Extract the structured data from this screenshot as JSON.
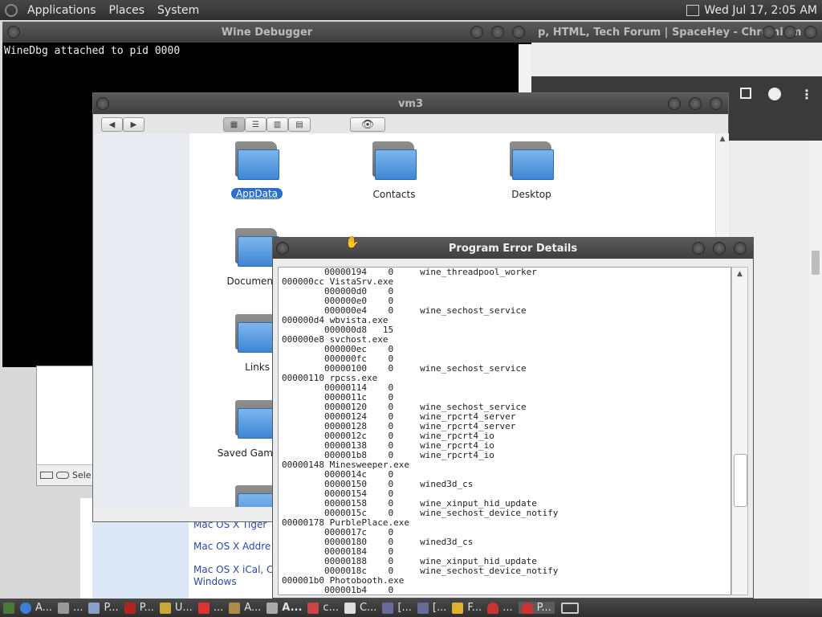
{
  "top_panel": {
    "menus": [
      "Applications",
      "Places",
      "System"
    ],
    "clock": "Wed Jul 17,  2:05 AM"
  },
  "chromium": {
    "title": "p, HTML, Tech Forum | SpaceHey - Chromium",
    "page_links": [
      "Mac OS X Tiger",
      "Mac OS X Addre",
      "Mac OS X iCal, C",
      "Windows"
    ]
  },
  "debugger": {
    "title": "Wine Debugger",
    "console_text": "WineDbg attached to pid 0000"
  },
  "side_window": {
    "status_text": "Sele"
  },
  "file_manager": {
    "title": "vm3",
    "folders": [
      {
        "label": "AppData",
        "selected": true
      },
      {
        "label": "Contacts",
        "selected": false
      },
      {
        "label": "Desktop",
        "selected": false
      },
      {
        "label": "Documen",
        "selected": false
      },
      {
        "label": "Links",
        "selected": false
      },
      {
        "label": "Saved Gam",
        "selected": false
      }
    ]
  },
  "error_dialog": {
    "title": "Program Error Details",
    "lines": [
      "        00000194    0     wine_threadpool_worker",
      "000000cc VistaSrv.exe",
      "        000000d0    0",
      "        000000e0    0",
      "        000000e4    0     wine_sechost_service",
      "000000d4 wbvista.exe",
      "        000000d8   15",
      "000000e8 svchost.exe",
      "        000000ec    0",
      "        000000fc    0",
      "        00000100    0     wine_sechost_service",
      "00000110 rpcss.exe",
      "        00000114    0",
      "        0000011c    0",
      "        00000120    0     wine_sechost_service",
      "        00000124    0     wine_rpcrt4_server",
      "        00000128    0     wine_rpcrt4_server",
      "        0000012c    0     wine_rpcrt4_io",
      "        00000138    0     wine_rpcrt4_io",
      "        000001b8    0     wine_rpcrt4_io",
      "00000148 Minesweeper.exe",
      "        0000014c    0",
      "        00000150    0     wined3d_cs",
      "        00000154    0",
      "        00000158    0     wine_xinput_hid_update",
      "        0000015c    0     wine_sechost_device_notify",
      "00000178 PurblePlace.exe",
      "        0000017c    0",
      "        00000180    0     wined3d_cs",
      "        00000184    0",
      "        00000188    0     wine_xinput_hid_update",
      "        0000018c    0     wine_sechost_device_notify",
      "000001b0 Photobooth.exe",
      "        000001b4    0"
    ]
  },
  "taskbar": {
    "items": [
      "A...",
      "...",
      "P...",
      "P...",
      "U...",
      "...",
      "A...",
      "A...",
      "c...",
      "C...",
      "[...",
      "[...",
      "F...",
      "...",
      "P..."
    ]
  },
  "colors": {
    "panel": "#3a3a3a",
    "selection": "#2a6fc9",
    "folder_blue": "#3d86d6"
  }
}
